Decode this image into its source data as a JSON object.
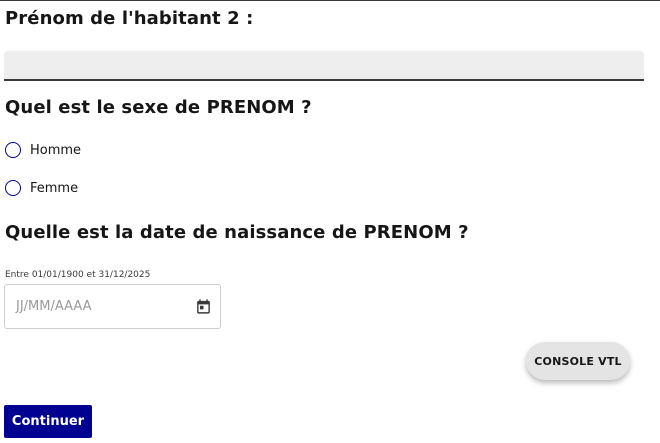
{
  "firstname_question": {
    "label": "Prénom de l'habitant 2 :",
    "value": ""
  },
  "sex_question": {
    "label": "Quel est le sexe de PRENOM ?",
    "options": [
      "Homme",
      "Femme"
    ]
  },
  "birthdate_question": {
    "label": "Quelle est la date de naissance de PRENOM ?",
    "hint": "Entre 01/01/1900 et 31/12/2025",
    "placeholder": "JJ/MM/AAAA"
  },
  "console_button": {
    "label": "CONSOLE VTL"
  },
  "continue_button": {
    "label": "Continuer"
  },
  "colors": {
    "primary": "#000091",
    "input_background": "#eeeeee",
    "text": "#161616"
  },
  "icons": {
    "date": "calendar-icon"
  }
}
